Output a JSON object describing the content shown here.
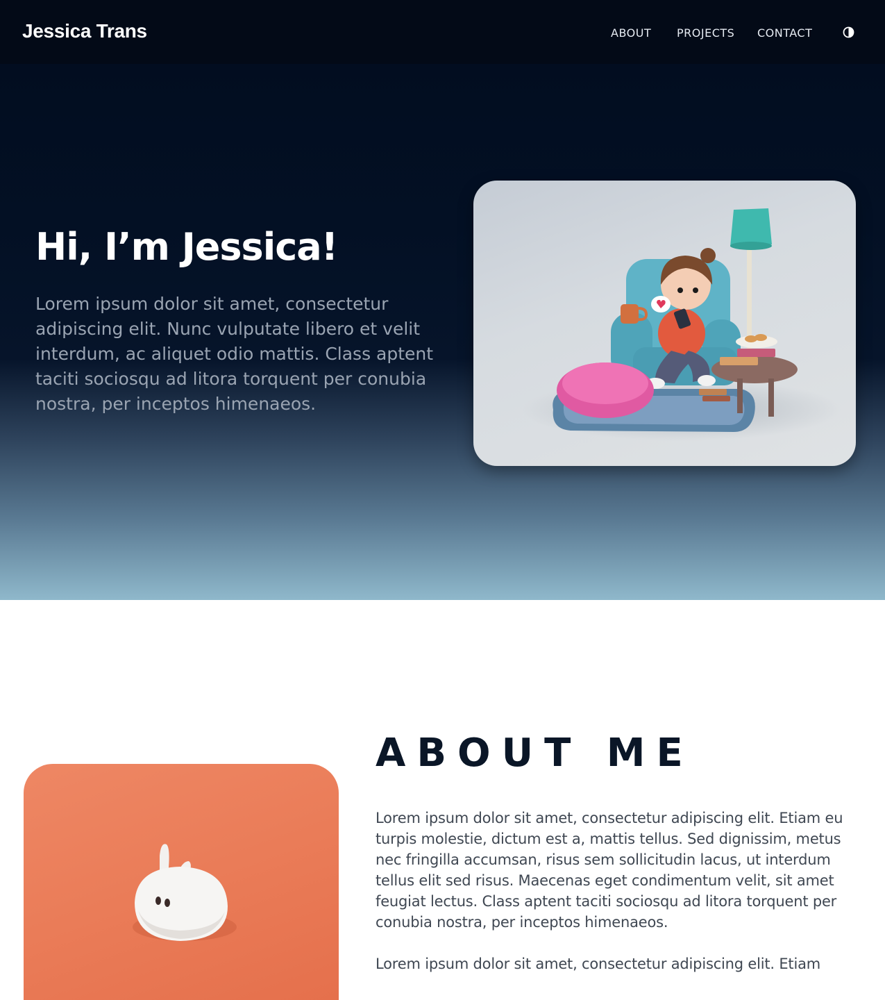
{
  "header": {
    "brand": "Jessica Trans",
    "nav": {
      "about": "ABOUT",
      "projects": "PROJECTS",
      "contact": "CONTACT"
    },
    "theme_toggle_icon": "contrast-icon"
  },
  "hero": {
    "title": "Hi, I’m Jessica!",
    "text": "Lorem ipsum dolor sit amet, consectetur adipiscing elit. Nunc vulputate libero et velit interdum, ac aliquet odio mattis. Class aptent taciti sociosqu ad litora torquent per conubia nostra, per inceptos himenaeos.",
    "image_subject": "3d-character-reading-on-armchair"
  },
  "about": {
    "title": "ABOUT ME",
    "paragraphs": [
      "Lorem ipsum dolor sit amet, consectetur adipiscing elit. Etiam eu turpis molestie, dictum est a, mattis tellus. Sed dignissim, metus nec fringilla accumsan, risus sem sollicitudin lacus, ut interdum tellus elit sed risus. Maecenas eget condimentum velit, sit amet feugiat lectus. Class aptent taciti sociosqu ad litora torquent per conubia nostra, per inceptos himenaeos.",
      "Lorem ipsum dolor sit amet, consectetur adipiscing elit. Etiam"
    ],
    "image_subject": "3d-white-bunny"
  },
  "colors": {
    "navbar_bg": "#030a17",
    "hero_top": "#020d20",
    "hero_bottom": "#8fb8cb",
    "about_title": "#0a1627",
    "about_image_bg": "#ea7c58"
  }
}
